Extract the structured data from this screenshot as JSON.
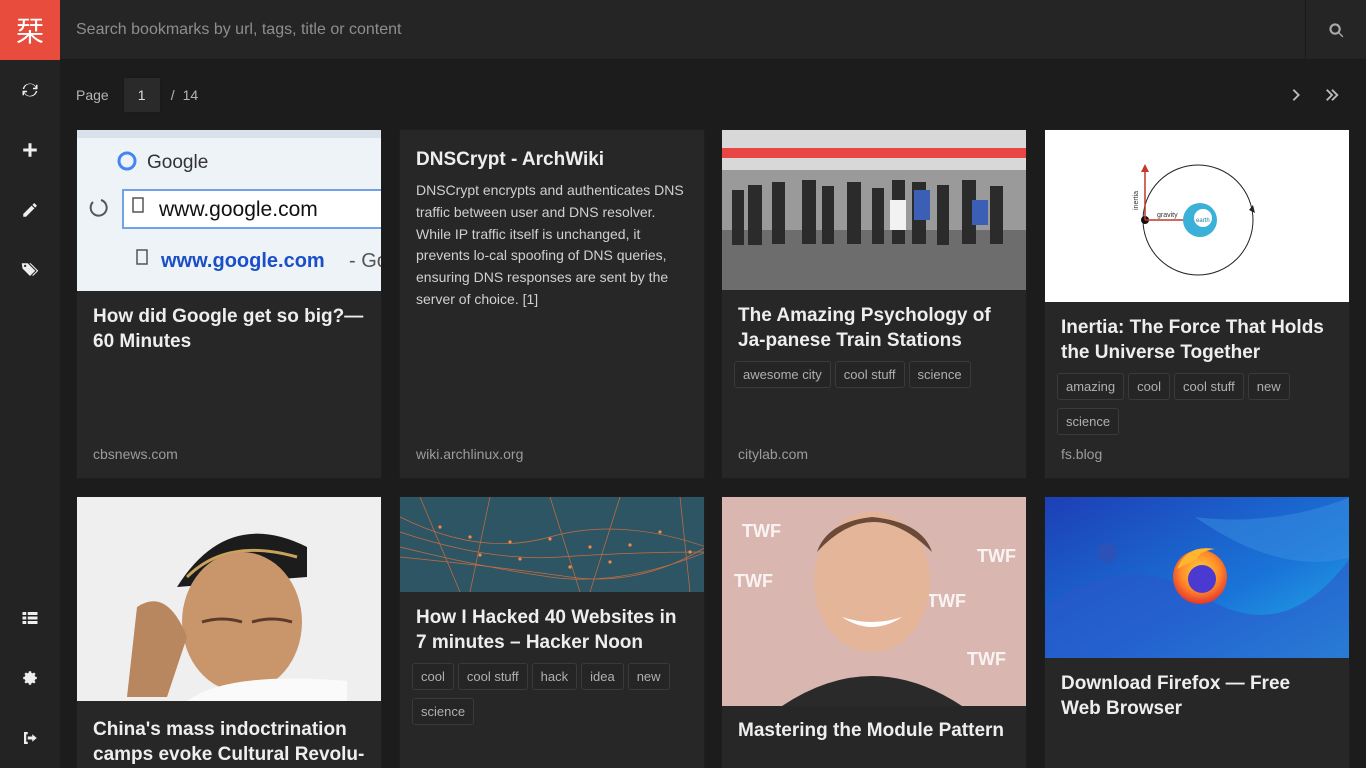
{
  "app": {
    "logo_glyph": "栞",
    "accent_color": "#e74c3c"
  },
  "sidebar": {
    "items": [
      {
        "icon": "refresh-icon"
      },
      {
        "icon": "plus-icon"
      },
      {
        "icon": "pencil-icon"
      },
      {
        "icon": "tags-icon"
      },
      {
        "icon": "list-icon"
      },
      {
        "icon": "gear-icon"
      },
      {
        "icon": "sign-out-icon"
      }
    ]
  },
  "search": {
    "placeholder": "Search bookmarks by url, tags, title or content",
    "value": "",
    "icon": "search-icon"
  },
  "pagination": {
    "label": "Page",
    "current": "1",
    "separator": "/",
    "total": "14"
  },
  "bookmarks": [
    {
      "title": "How did Google get so big?—60 Minutes",
      "domain": "cbsnews.com",
      "tags": [],
      "thumbnail": "google address bar screenshot"
    },
    {
      "title": "DNSCrypt - ArchWiki",
      "excerpt": "DNSCrypt encrypts and authenticates DNS traffic between user and DNS resolver. While IP traffic itself is unchanged, it prevents lo-cal spoofing of DNS queries, ensuring DNS responses are sent by the server of choice. [1]",
      "domain": "wiki.archlinux.org",
      "tags": []
    },
    {
      "title": "The Amazing Psychology of Ja-panese Train Stations",
      "domain": "citylab.com",
      "tags": [
        "awesome city",
        "cool stuff",
        "science"
      ],
      "thumbnail": "people queuing at train platform"
    },
    {
      "title": "Inertia: The Force That Holds the Universe Together",
      "domain": "fs.blog",
      "tags": [
        "amazing",
        "cool",
        "cool stuff",
        "new",
        "science"
      ],
      "thumbnail": "inertia gravity diagram",
      "thumb_text": {
        "inertia": "inertia",
        "gravity": "gravity",
        "earth": "earth"
      }
    },
    {
      "title": "China's mass indoctrination camps evoke Cultural Revolu-",
      "domain": "",
      "tags": [],
      "thumbnail": "man with cap thinking"
    },
    {
      "title": "How I Hacked 40 Websites in 7 minutes – Hacker Noon",
      "domain": "",
      "tags": [
        "cool",
        "cool stuff",
        "hack",
        "idea",
        "new",
        "science"
      ],
      "thumbnail": "network particles"
    },
    {
      "title": "Mastering the Module Pattern",
      "domain": "",
      "tags": [],
      "thumbnail": "smiling man at TWF backdrop",
      "thumb_text": "TWF"
    },
    {
      "title": "Download Firefox — Free Web Browser",
      "domain": "",
      "tags": [],
      "thumbnail": "firefox logo on blue"
    }
  ]
}
